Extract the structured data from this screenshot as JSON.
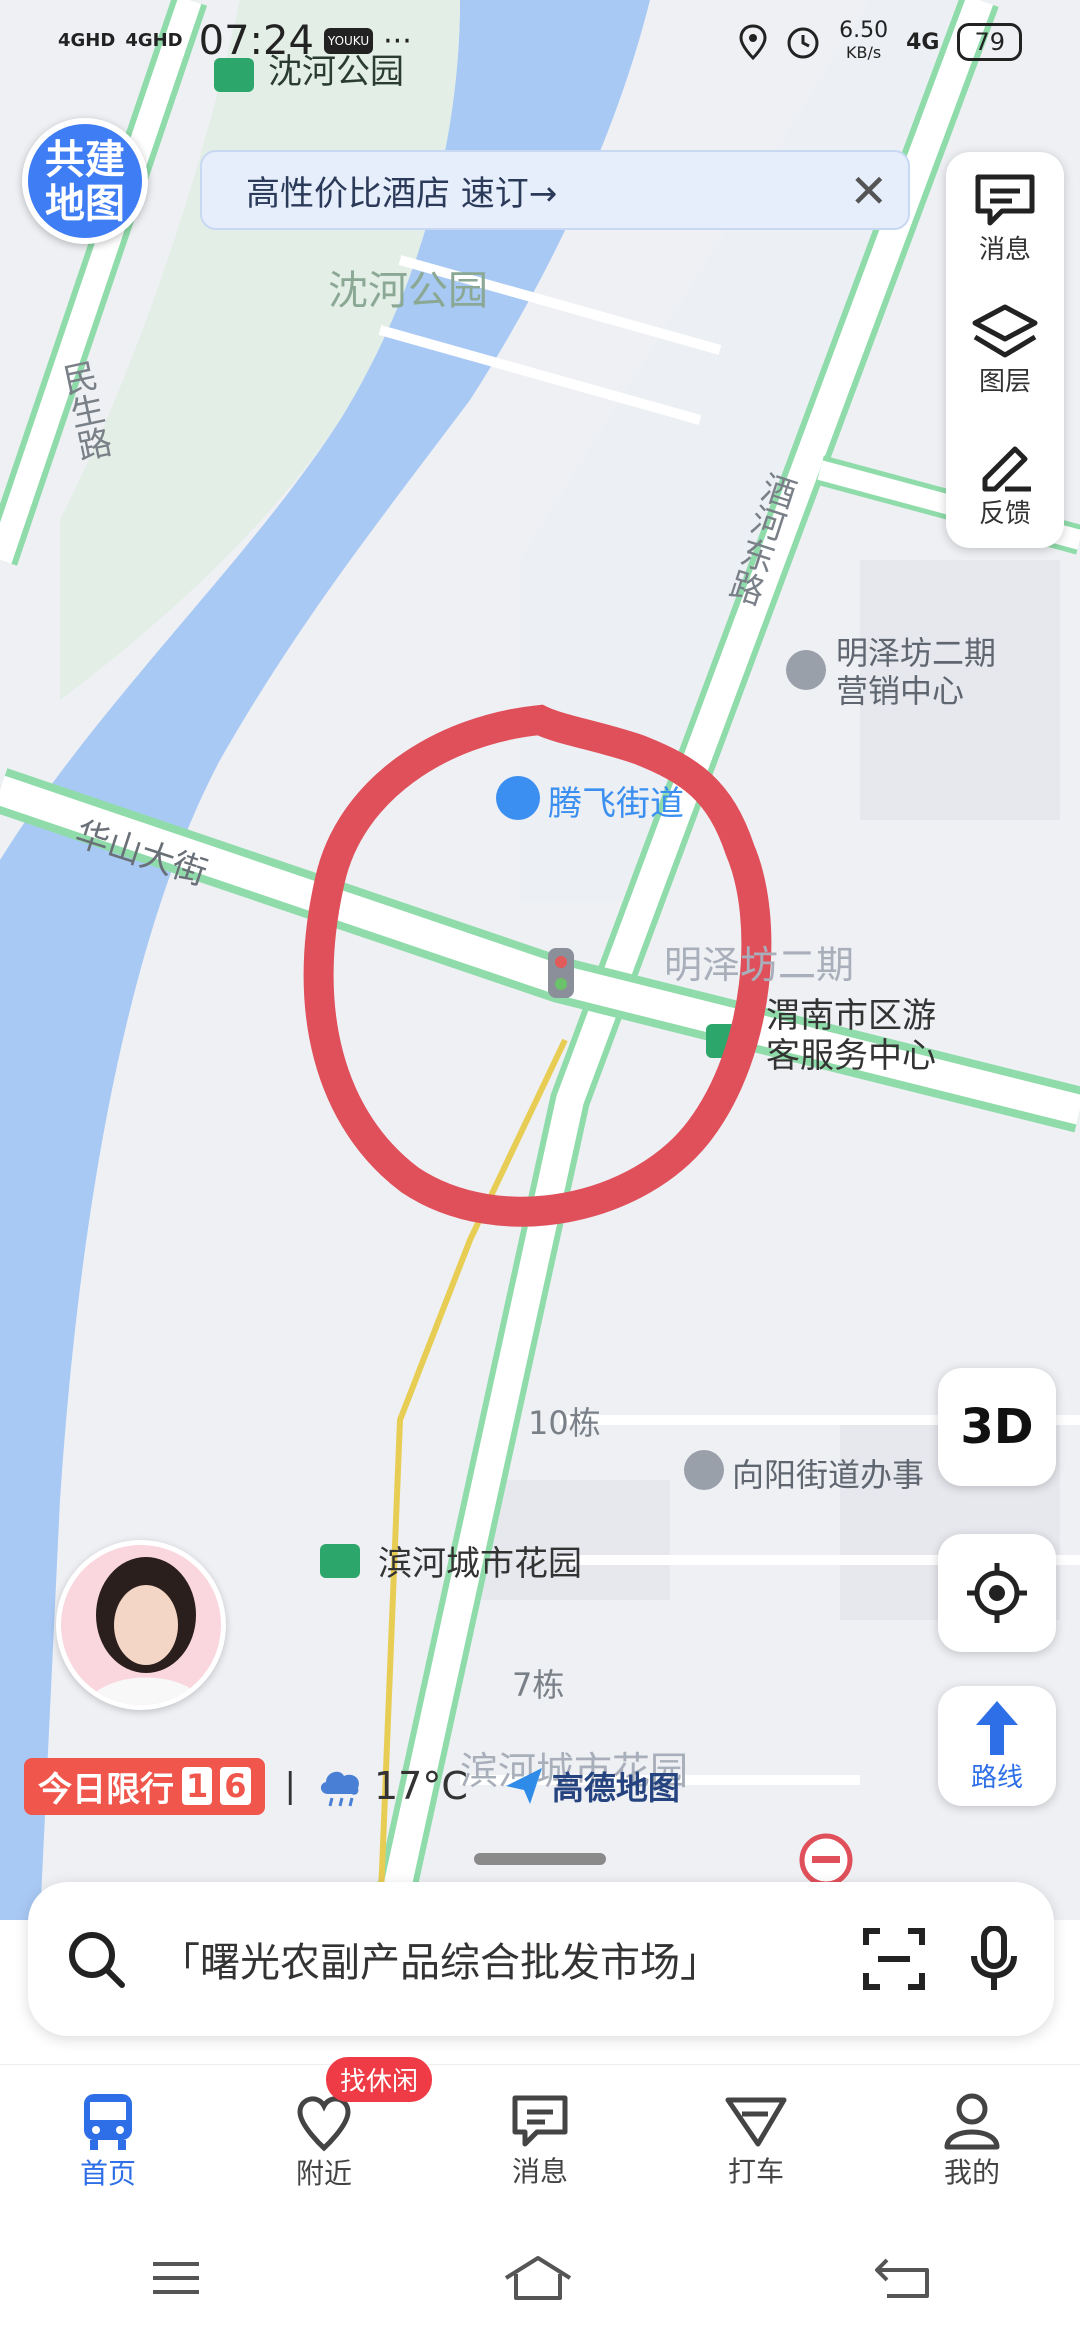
{
  "status_bar": {
    "signal1": "4GHD",
    "signal2": "4GHD",
    "time": "07:24",
    "app_icon": "YOUKU",
    "more": "···",
    "speed_value": "6.50",
    "speed_unit": "KB/s",
    "network": "4G",
    "battery": "79"
  },
  "logo": {
    "line1": "共建",
    "line2": "地图"
  },
  "banner": {
    "text": "高性价比酒店 速订→"
  },
  "side_panel": {
    "messages": "消息",
    "layers": "图层",
    "feedback": "反馈"
  },
  "map_labels": {
    "park_bus": "沈河公园",
    "park_name": "沈河公园",
    "minsheng_road": "民生路",
    "jiuhe_east_road": "酒河东路",
    "mingzefang_sales": "明泽坊二期营销中心",
    "mingzefang_sales_line1": "明泽坊二期",
    "mingzefang_sales_line2": "营销中心",
    "tengfei_street": "腾飞街道",
    "huashan_avenue": "华山大街",
    "mingzefang": "明泽坊二期",
    "visitor_center_line1": "渭南市区游",
    "visitor_center_line2": "客服务中心",
    "bldg10": "10栋",
    "xiangyang_office": "向阳街道办事",
    "binhe_bus": "滨河城市花园",
    "bldg7": "7栋",
    "binhe_area": "滨河城市花园"
  },
  "controls": {
    "view_3d": "3D",
    "route": "路线"
  },
  "info_row": {
    "restriction_label": "今日限行",
    "restriction_digit1": "1",
    "restriction_digit2": "6",
    "divider": "|",
    "temperature": "17°C",
    "amap_brand": "高德地图"
  },
  "search": {
    "placeholder": "「曙光农副产品综合批发市场」"
  },
  "tabs": [
    {
      "label": "首页"
    },
    {
      "label": "附近",
      "badge": "找休闲"
    },
    {
      "label": "消息"
    },
    {
      "label": "打车"
    },
    {
      "label": "我的"
    }
  ],
  "colors": {
    "accent": "#2e6fe8",
    "river": "#a9c9f5",
    "road_green": "#8fdcaa",
    "annotation": "#e0505a"
  }
}
